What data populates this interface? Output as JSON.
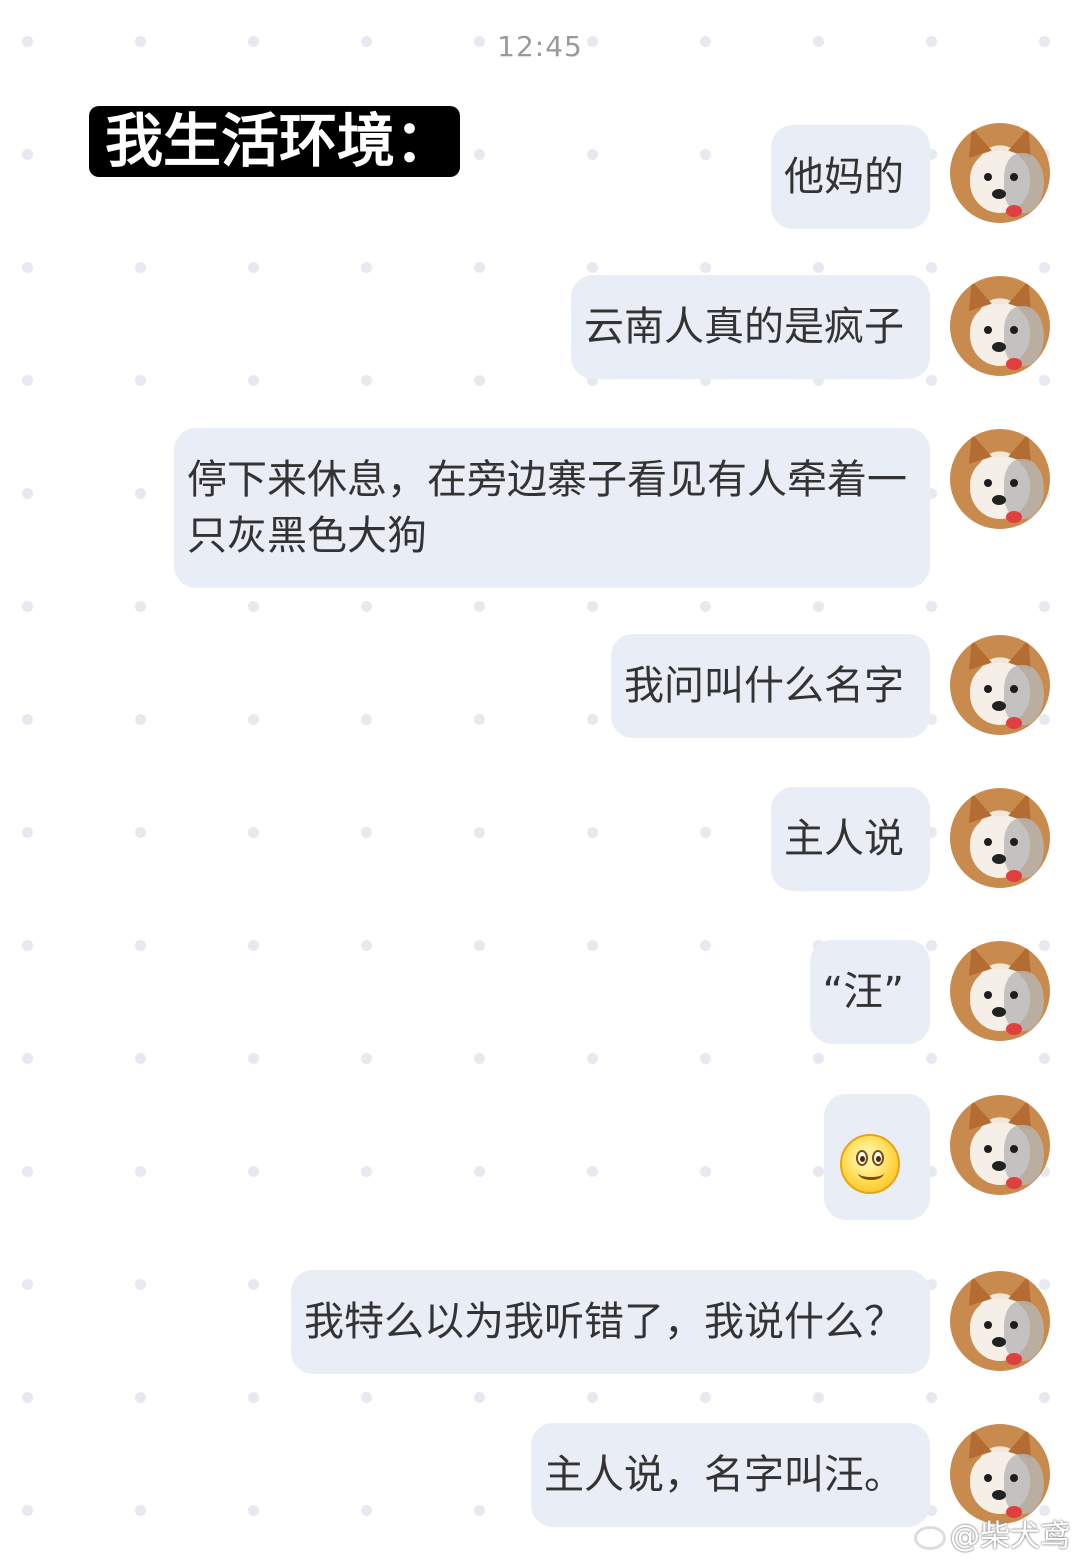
{
  "status_bar": {
    "time": "12:45"
  },
  "header_sticker": {
    "text": "我生活环境："
  },
  "messages": [
    {
      "text": "他妈的"
    },
    {
      "text": "云南人真的是疯子"
    },
    {
      "text": "停下来休息，在旁边寨子看见有人牵着一只灰黑色大狗"
    },
    {
      "text": "我问叫什么名字"
    },
    {
      "text": "主人说"
    },
    {
      "text": "“汪”"
    },
    {
      "emoji": "smile-emoji"
    },
    {
      "text": "我特么以为我听错了，我说什么？"
    },
    {
      "text": "主人说，名字叫汪。"
    }
  ],
  "avatar": {
    "icon": "shiba-dog-avatar"
  },
  "watermark": {
    "text": "@柴犬鸢"
  }
}
